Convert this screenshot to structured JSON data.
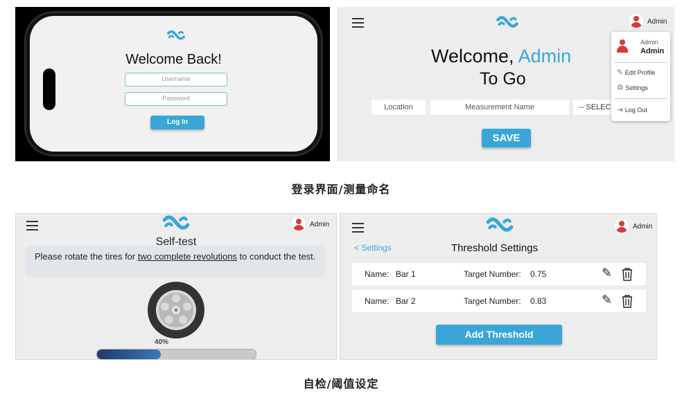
{
  "login": {
    "title": "Welcome Back!",
    "username_placeholder": "Username",
    "password_placeholder": "Password",
    "login_button": "Log In"
  },
  "naming": {
    "user_menu_label": "Admin",
    "welcome_prefix": "Welcome,",
    "welcome_name": "Admin",
    "subtitle": "To Go",
    "location_placeholder": "Location",
    "measurement_placeholder": "Measurement Name",
    "select_placeholder": "-- SELEC",
    "save_button": "SAVE",
    "dropdown": {
      "role": "Admin",
      "name": "Admin",
      "edit_profile": "Edit Profile",
      "settings": "Settings",
      "log_out": "Log Out"
    }
  },
  "caption_top": "登录界面/测量命名",
  "selftest": {
    "user_label": "Admin",
    "title": "Self-test",
    "instruction_before": "Please rotate the tires for ",
    "instruction_link": "two complete revolutions",
    "instruction_after": " to conduct the test.",
    "progress_label": "40%",
    "progress_value": 0.4
  },
  "threshold": {
    "user_label": "Admin",
    "back_link": "< Settings",
    "title": "Threshold Settings",
    "name_label": "Name:",
    "target_label": "Target Number:",
    "items": [
      {
        "name": "Bar 1",
        "target": "0.75"
      },
      {
        "name": "Bar 2",
        "target": "0.83"
      }
    ],
    "add_button": "Add Threshold"
  },
  "caption_bottom": "自检/阈值设定",
  "colors": {
    "accent": "#3aa6d8",
    "avatar": "#d63a3a",
    "panel_bg": "#ededed"
  }
}
